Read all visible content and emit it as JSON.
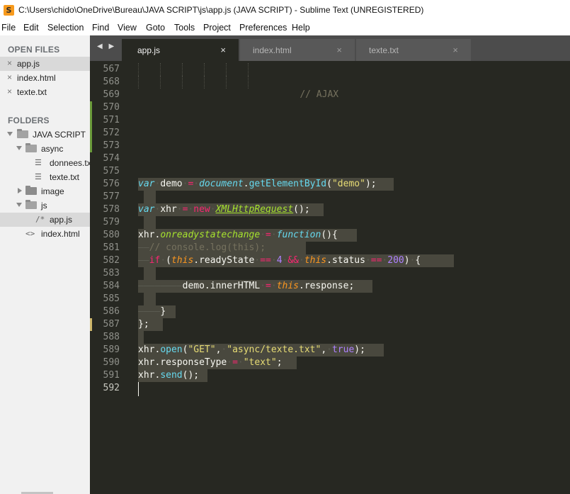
{
  "window": {
    "title": "C:\\Users\\chido\\OneDrive\\Bureau\\JAVA SCRIPT\\js\\app.js (JAVA SCRIPT) - Sublime Text (UNREGISTERED)",
    "icon": "sublime-text-icon"
  },
  "menu": [
    "File",
    "Edit",
    "Selection",
    "Find",
    "View",
    "Goto",
    "Tools",
    "Project",
    "Preferences",
    "Help"
  ],
  "sidebar": {
    "open_files_heading": "OPEN FILES",
    "open_files": [
      "app.js",
      "index.html",
      "texte.txt"
    ],
    "folders_heading": "FOLDERS",
    "tree": {
      "root": "JAVA SCRIPT",
      "async": "async",
      "donnees": "donnees.txt",
      "texte": "texte.txt",
      "image": "image",
      "js": "js",
      "appjs": "app.js",
      "index": "index.html"
    }
  },
  "tabs": [
    {
      "label": "app.js",
      "close": "×",
      "active": true
    },
    {
      "label": "index.html",
      "close": "×",
      "active": false
    },
    {
      "label": "texte.txt",
      "close": "×",
      "active": false
    }
  ],
  "tab_arrows": "◀ ▶",
  "editor": {
    "line_numbers": [
      "567",
      "568",
      "569",
      "570",
      "571",
      "572",
      "573",
      "574",
      "575",
      "576",
      "577",
      "578",
      "579",
      "580",
      "581",
      "582",
      "583",
      "584",
      "585",
      "586",
      "587",
      "588",
      "589",
      "590",
      "591",
      "592"
    ],
    "comment_568": "// AJAX",
    "code": {
      "l576": [
        "var",
        "demo",
        "=",
        "document",
        ".",
        "getElementById",
        "(",
        "\"demo\"",
        ");"
      ],
      "l578": [
        "var",
        "xhr",
        "=",
        "new",
        "XMLHttpRequest",
        "();"
      ],
      "l580": [
        "xhr",
        ".",
        "onreadystatechange",
        "=",
        "function",
        "(){"
      ],
      "l581": "// console.log(this);",
      "l582": [
        "if",
        "(",
        "this",
        ".readyState",
        "==",
        "4",
        "&&",
        "this",
        ".status",
        "==",
        "200",
        ")",
        "{"
      ],
      "l584": [
        "demo.innerHTML",
        "=",
        "this",
        ".response;"
      ],
      "l586": "}",
      "l587": "};",
      "l589": [
        "xhr.",
        "open",
        "(",
        "\"GET\"",
        ",",
        "\"async/texte.txt\"",
        ",",
        "true",
        ");"
      ],
      "l590": [
        "xhr.responseType",
        "=",
        "\"text\"",
        ";"
      ],
      "l591": [
        "xhr.",
        "send",
        "();"
      ]
    }
  }
}
